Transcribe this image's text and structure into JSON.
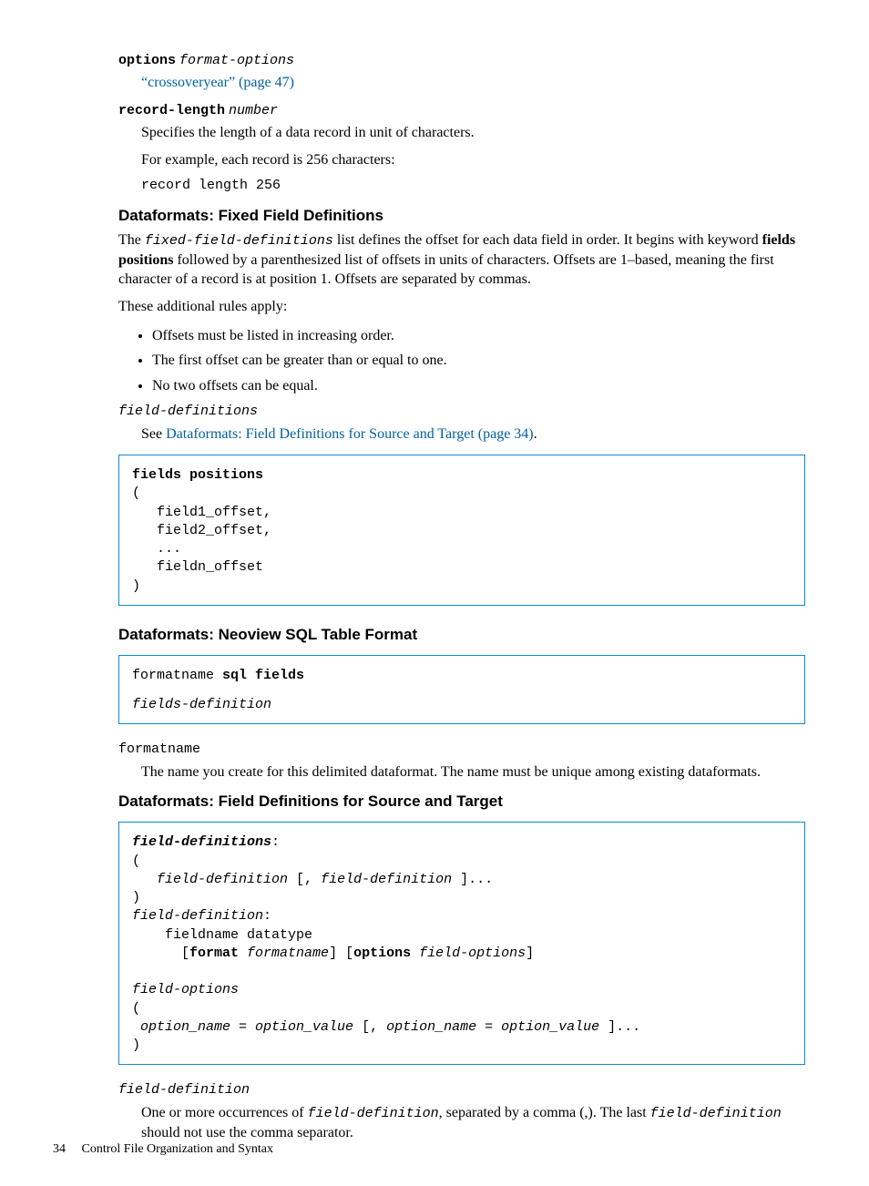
{
  "entry_options": {
    "term_kw": "options",
    "term_arg": "format-options",
    "link_text": "“crossoveryear” (page 47)"
  },
  "entry_recordlen": {
    "term_kw": "record-length",
    "term_arg": "number",
    "def1": "Specifies the length of a data record in unit of characters.",
    "def2": "For example, each record is 256 characters:",
    "code": "record length 256"
  },
  "sec_fixed": {
    "heading": "Dataformats: Fixed Field Definitions",
    "para_parts": {
      "pre": "The ",
      "code": "fixed-field-definitions",
      "post1": " list defines the offset for each data field in order. It begins with keyword ",
      "bold": "fields positions",
      "post2": " followed by a parenthesized list of offsets in units of characters. Offsets are 1–based, meaning the first character of a record is at position 1. Offsets are separated by commas."
    },
    "rules_intro": "These additional rules apply:",
    "rules": [
      "Offsets must be listed in increasing order.",
      "The first offset can be greater than or equal to one.",
      "No two offsets can be equal."
    ],
    "field_defs_term": "field-definitions",
    "field_defs_def_pre": "See ",
    "field_defs_link": "Dataformats: Field Definitions for Source and Target (page 34)",
    "field_defs_def_post": ".",
    "codebox": {
      "kw": "fields positions",
      "body": "(\n   field1_offset,\n   field2_offset,\n   ...\n   fieldn_offset\n)"
    }
  },
  "sec_neoview": {
    "heading": "Dataformats: Neoview SQL Table Format",
    "code_line1_a": "formatname ",
    "code_line1_b": "sql fields",
    "code_line2": "fields-definition",
    "term": "formatname",
    "def": "The name you create for this delimited dataformat. The name must be unique among existing dataformats."
  },
  "sec_fielddefs": {
    "heading": "Dataformats: Field Definitions for Source and Target",
    "code": {
      "l1a": "field-definitions",
      "l1b": ":",
      "l2": "(",
      "l3pre": "   ",
      "l3a": "field-definition",
      "l3mid": " [, ",
      "l3b": "field-definition",
      "l3post": " ]...",
      "l4": ")",
      "l5a": "field-definition",
      "l5b": ":",
      "l6": "    fieldname datatype",
      "l7pre": "      [",
      "l7kw1": "format",
      "l7sp1": " ",
      "l7a": "formatname",
      "l7mid": "] [",
      "l7kw2": "options",
      "l7sp2": " ",
      "l7b": "field-options",
      "l7post": "]",
      "blank": "",
      "l8": "field-options",
      "l9": "(",
      "l10pre": " ",
      "l10a": "option_name = option_value",
      "l10mid": " [, ",
      "l10b": "option_name = option_value",
      "l10post": " ]...",
      "l11": ")"
    },
    "term": "field-definition",
    "def_parts": {
      "a": "One or more occurrences of ",
      "c1": "field-definition",
      "b": ", separated by a comma (,). The last ",
      "c2": "field-definition",
      "c": " should not use the comma separator."
    }
  },
  "footer": {
    "page": "34",
    "title": "Control File Organization and Syntax"
  }
}
